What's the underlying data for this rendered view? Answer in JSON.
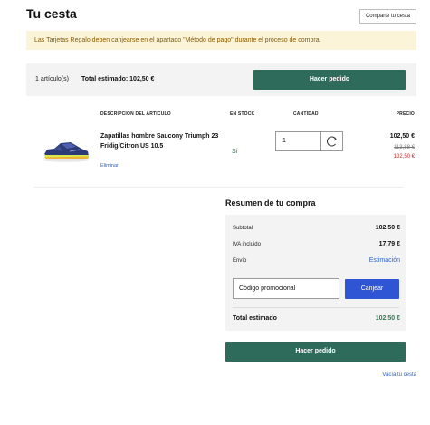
{
  "header": {
    "title": "Tu cesta",
    "share_label": "Comparte tu cesta"
  },
  "notice": {
    "text": "Las Tarjetas Regalo deben canjearse en el apartado \"Método de pago\" durante el proceso de compra."
  },
  "summary_bar": {
    "count": "1 artículo(s)",
    "total": "Total estimado: 102,50 €",
    "order_label": "Hacer pedido"
  },
  "columns": {
    "description": "DESCRIPCIÓN DEL ARTÍCULO",
    "stock": "EN STOCK",
    "quantity": "CANTIDAD",
    "price": "PRECIO"
  },
  "item": {
    "name": "Zapatillas hombre Saucony Triumph 23 Fridig/Citron US 10.5",
    "remove": "Eliminar",
    "stock": "Sí",
    "quantity": "1",
    "price": "102,50 €",
    "old_price": "113,88 €",
    "sale_price": "102,50 €"
  },
  "order_summary": {
    "title": "Resumen de tu compra",
    "subtotal_label": "Subtotal",
    "subtotal_value": "102,50 €",
    "vat_label": "IVA incluido",
    "vat_value": "17,79 €",
    "shipping_label": "Envío",
    "shipping_value": "Estimación",
    "promo_placeholder": "Código promocional",
    "redeem_label": "Canjear",
    "total_label": "Total estimado",
    "total_value": "102,50 €",
    "order_label": "Hacer pedido",
    "empty_label": "Vacía tu cesta"
  },
  "colors": {
    "primary_green": "#2f6b5a",
    "link_blue": "#2d62c8",
    "redeem_blue": "#2f55d4",
    "sale_red": "#c62828",
    "stock_green": "#2e7d4f",
    "notice_bg": "#fbf4d8"
  },
  "icons": {
    "refresh": "refresh-icon"
  }
}
